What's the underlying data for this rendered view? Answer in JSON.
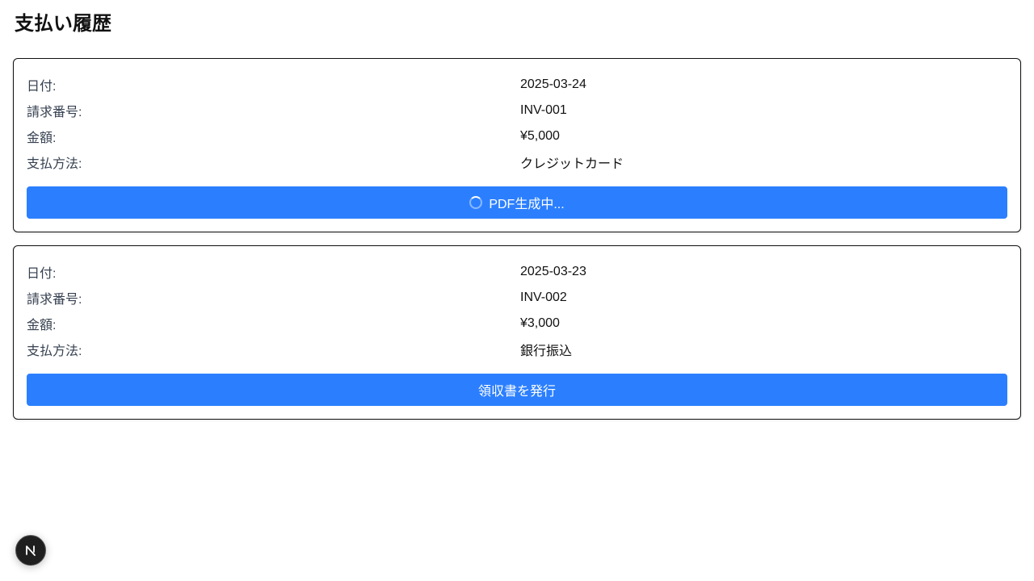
{
  "page": {
    "title": "支払い履歴"
  },
  "labels": {
    "date": "日付:",
    "invoice_number": "請求番号:",
    "amount": "金額:",
    "payment_method": "支払方法:"
  },
  "payments": [
    {
      "date": "2025-03-24",
      "invoice_number": "INV-001",
      "amount": "¥5,000",
      "payment_method": "クレジットカード",
      "button_label": "PDF生成中...",
      "button_state": "loading"
    },
    {
      "date": "2025-03-23",
      "invoice_number": "INV-002",
      "amount": "¥3,000",
      "payment_method": "銀行振込",
      "button_label": "領収書を発行",
      "button_state": "idle"
    }
  ],
  "dev_indicator": {
    "letter": "N",
    "icon": "nextjs-logo-icon"
  },
  "colors": {
    "button": "#2b7fff",
    "card_border": "#111111",
    "dev_badge": "#1f1f1f"
  }
}
